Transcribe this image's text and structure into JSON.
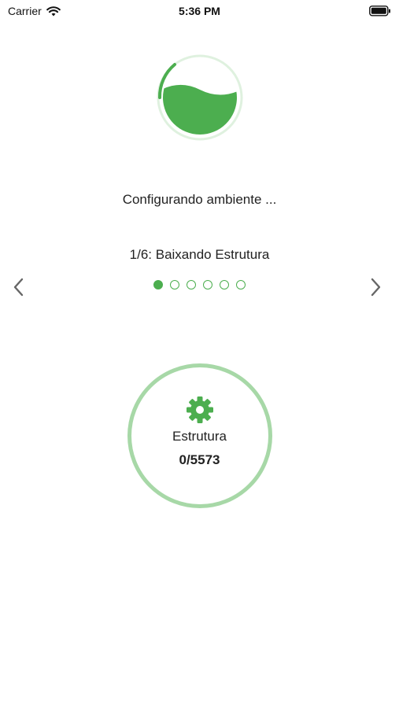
{
  "status_bar": {
    "carrier": "Carrier",
    "time": "5:36 PM"
  },
  "loader": {
    "icon": "water-fill-loader",
    "color": "#4cae4f",
    "track_color": "#dff1df"
  },
  "main": {
    "status_text": "Configurando ambiente ...",
    "step_text": "1/6: Baixando Estrutura",
    "steps_total": 6,
    "current_step": 1
  },
  "navigation": {
    "prev_icon": "chevron-left-icon",
    "next_icon": "chevron-right-icon"
  },
  "progress": {
    "icon": "gear-icon",
    "label": "Estrutura",
    "count": "0/5573",
    "ring_color": "#a7d8a7",
    "accent": "#4cae4f"
  }
}
